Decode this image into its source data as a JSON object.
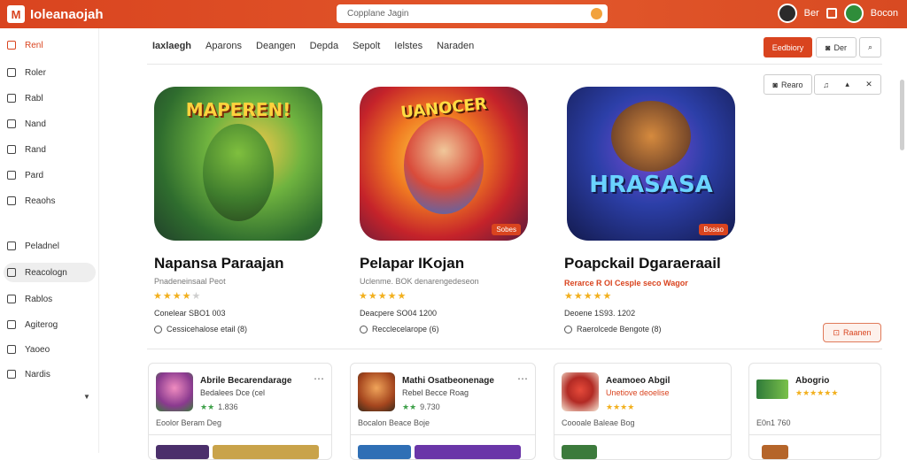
{
  "app": {
    "title": "Ioleanaojah",
    "logo_glyph": "M",
    "brand_color": "#d9441f"
  },
  "search": {
    "placeholder": "Copplane Jagin"
  },
  "topbar": {
    "user1": "Ber",
    "user2": "Bocon"
  },
  "sidebar": {
    "items": [
      {
        "label": "Renl",
        "icon": "home-icon",
        "active": true
      },
      {
        "label": "Roler",
        "icon": "roles-icon"
      },
      {
        "label": "Rabl",
        "icon": "doc-icon"
      },
      {
        "label": "Nand",
        "icon": "file-icon"
      },
      {
        "label": "Rand",
        "icon": "folder-icon"
      },
      {
        "label": "Pard",
        "icon": "card-icon"
      },
      {
        "label": "Reaohs",
        "icon": "grid-icon"
      },
      {
        "label": "Peladnel",
        "icon": "chat-icon"
      },
      {
        "label": "Reacologn",
        "icon": "tag-icon",
        "highlighted": true
      },
      {
        "label": "Rablos",
        "icon": "list-icon"
      },
      {
        "label": "Agiterog",
        "icon": "edit-icon"
      },
      {
        "label": "Yaoeo",
        "icon": "star-icon"
      },
      {
        "label": "Nardis",
        "icon": "menu-icon"
      }
    ]
  },
  "tabs": [
    "Iaxlaegh",
    "Aparons",
    "Deangen",
    "Depda",
    "Sepolt",
    "Ielstes",
    "Naraden"
  ],
  "header_buttons": {
    "primary": "Eedbiory",
    "secondary": "Der",
    "small_icons": [
      "Rearo"
    ]
  },
  "featured": [
    {
      "art_title": "MAPEREN!",
      "title": "Napansa Paraajan",
      "subtitle": "Pnadeneinsaal Peot",
      "rating": 4,
      "meta": "Conelear SBO1 003",
      "line": "Cessicehalose etail (8)",
      "badge": ""
    },
    {
      "art_title": "UANOCER",
      "title": "Pelapar IKojan",
      "subtitle": "Uclenme. BOK denarengedeseon",
      "rating": 5,
      "meta": "Deacpere SO04 1200",
      "line": "Recclecelarope (6)",
      "badge": "Sobes"
    },
    {
      "art_title": "HRASASA",
      "title": "Poapckail Dgaraeraail",
      "subtitle": "Rerarce R OI Cesple seco Wagor",
      "rating": 5,
      "meta": "Deoene 1S93. 1202",
      "line": "Raerolcede Bengote (8)",
      "badge": "Bosao"
    }
  ],
  "featured_action": "Raanen",
  "cards": [
    {
      "name": "Abrile Becarendarage",
      "desc": "Bedalees Dce (cel",
      "rating": "1.836",
      "bottom": "Eoolor    Beram Deg"
    },
    {
      "name": "Mathi Osatbeonenage",
      "desc": "Rebel Becce Roag",
      "rating": "9.730",
      "bottom": "Bocalon    Beace Boje"
    },
    {
      "name": "Aeamoeo Abgil",
      "desc": "Unetiove deoelise",
      "rating": "",
      "bottom": "Coooale    Baleae Bog"
    },
    {
      "name": "Abogrio",
      "desc": "",
      "rating": "",
      "bottom": "E0n1 760"
    }
  ]
}
